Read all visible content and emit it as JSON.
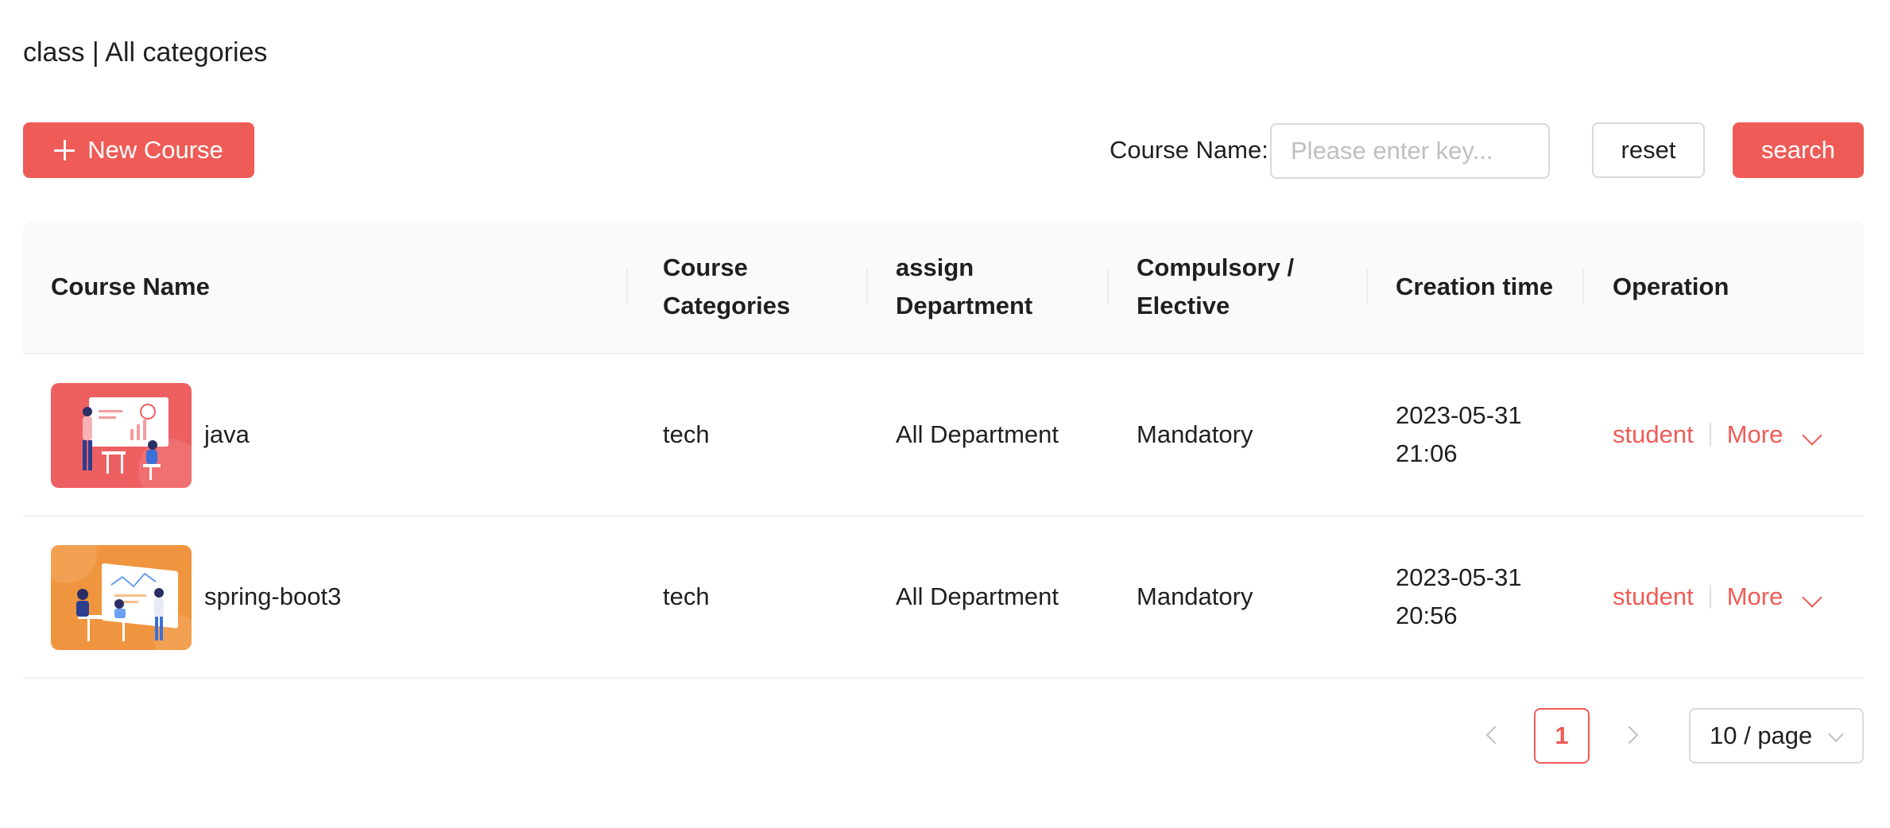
{
  "breadcrumb": "class | All categories",
  "toolbar": {
    "new_course_label": "New Course",
    "filter_label": "Course Name:",
    "filter_placeholder": "Please enter key...",
    "filter_value": "",
    "reset_label": "reset",
    "search_label": "search"
  },
  "colors": {
    "accent": "#ef5b56",
    "thumb_java": "#ee5f62",
    "thumb_spring": "#f0953f"
  },
  "table": {
    "columns": [
      "Course Name",
      "Course Categories",
      "assign Department",
      "Compulsory / Elective",
      "Creation time",
      "Operation"
    ],
    "rows": [
      {
        "thumbnail": "presentation-illustration-red",
        "name": "java",
        "category": "tech",
        "department": "All Department",
        "type": "Mandatory",
        "created": "2023-05-31 21:06",
        "op_student": "student",
        "op_more": "More"
      },
      {
        "thumbnail": "meeting-illustration-orange",
        "name": "spring-boot3",
        "category": "tech",
        "department": "All Department",
        "type": "Mandatory",
        "created": "2023-05-31 20:56",
        "op_student": "student",
        "op_more": "More"
      }
    ]
  },
  "pagination": {
    "current_page": "1",
    "page_size": "10 / page"
  }
}
